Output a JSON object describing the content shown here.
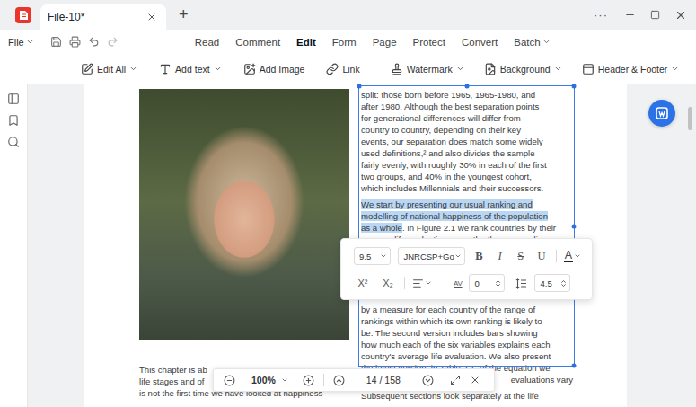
{
  "window": {
    "title": "File-10*",
    "new_tab": "+",
    "more": "···"
  },
  "menu": {
    "file": "File",
    "tabs": [
      {
        "label": "Read",
        "selected": false,
        "dropdown": false
      },
      {
        "label": "Comment",
        "selected": false,
        "dropdown": false
      },
      {
        "label": "Edit",
        "selected": true,
        "dropdown": false
      },
      {
        "label": "Form",
        "selected": false,
        "dropdown": false
      },
      {
        "label": "Page",
        "selected": false,
        "dropdown": false
      },
      {
        "label": "Protect",
        "selected": false,
        "dropdown": false
      },
      {
        "label": "Convert",
        "selected": false,
        "dropdown": false
      },
      {
        "label": "Batch",
        "selected": false,
        "dropdown": true
      }
    ]
  },
  "toolbar": {
    "edit_tools": [
      {
        "label": "Edit All",
        "dropdown": true
      },
      {
        "label": "Add text",
        "dropdown": true
      },
      {
        "label": "Add Image",
        "dropdown": false
      },
      {
        "label": "Link",
        "dropdown": false
      }
    ],
    "page_tools": [
      {
        "label": "Watermark",
        "dropdown": true
      },
      {
        "label": "Background",
        "dropdown": true
      },
      {
        "label": "Header & Footer",
        "dropdown": true
      }
    ]
  },
  "document": {
    "left_column": {
      "lines": [
        "This chapter is ab",
        "life stages and of",
        "is not the first time we have looked at happiness"
      ]
    },
    "right_column": {
      "above_toolbar": [
        {
          "lines": [
            {
              "segments": [
                {
                  "text": "split: those born before 1965, 1965-1980, and",
                  "highlighted": false
                }
              ],
              "cut_start": false
            },
            {
              "segments": [
                {
                  "text": "after 1980. Although the best separation points",
                  "highlighted": false
                }
              ],
              "cut_start": false
            },
            {
              "segments": [
                {
                  "text": "for generational differences will differ from",
                  "highlighted": false
                }
              ],
              "cut_start": false
            },
            {
              "segments": [
                {
                  "text": "country to country, depending on their key",
                  "highlighted": false
                }
              ],
              "cut_start": false
            },
            {
              "segments": [
                {
                  "text": "events, our separation does match some widely",
                  "highlighted": false
                }
              ],
              "cut_start": false
            },
            {
              "segments": [
                {
                  "text": "used definitions,² and also divides the sample",
                  "highlighted": false
                }
              ],
              "cut_start": false
            },
            {
              "segments": [
                {
                  "text": "fairly evenly, with roughly 30% in each of the first",
                  "highlighted": false
                }
              ],
              "cut_start": false
            },
            {
              "segments": [
                {
                  "text": "two groups, and 40% in the youngest cohort,",
                  "highlighted": false
                }
              ],
              "cut_start": false
            },
            {
              "segments": [
                {
                  "text": "which includes Millennials and their successors.",
                  "highlighted": false
                }
              ],
              "cut_start": false
            }
          ]
        },
        {
          "lines": [
            {
              "segments": [
                {
                  "text": "We start by presenting our usual ranking and",
                  "highlighted": true
                }
              ],
              "cut_start": false
            },
            {
              "segments": [
                {
                  "text": "modelling of national happiness of the population",
                  "highlighted": true
                }
              ],
              "cut_start": false
            },
            {
              "segments": [
                {
                  "text": "as a whole",
                  "highlighted": true
                },
                {
                  "text": ". In Figure 2.1 we rank countries by their",
                  "highlighted": false
                }
              ],
              "cut_start": false
            },
            {
              "segments": [
                {
                  "text": "average life evaluations over the three preceding",
                  "highlighted": false
                }
              ],
              "cut_start": false
            }
          ]
        }
      ],
      "below_toolbar": [
        {
          "lines": [
            {
              "segments": [
                {
                  "text": "by a measure for each country of the range of",
                  "highlighted": false
                }
              ],
              "cut_start": false
            },
            {
              "segments": [
                {
                  "text": "rankings within which its own ranking is likely to",
                  "highlighted": false
                }
              ],
              "cut_start": false
            },
            {
              "segments": [
                {
                  "text": "be. The second version includes bars showing",
                  "highlighted": false
                }
              ],
              "cut_start": false
            },
            {
              "segments": [
                {
                  "text": "how much each of the six variables explains each",
                  "highlighted": false
                }
              ],
              "cut_start": false
            },
            {
              "segments": [
                {
                  "text": "country's average life evaluation. We also present",
                  "highlighted": false
                }
              ],
              "cut_start": false
            },
            {
              "segments": [
                {
                  "text": "the latest version, in Table 2.1, of the equation we",
                  "highlighted": false
                }
              ],
              "cut_start": false
            },
            {
              "segments": [
                {
                  "text": "evaluations vary",
                  "highlighted": false
                }
              ],
              "cut_start": true
            }
          ]
        },
        {
          "lines": [
            {
              "segments": [
                {
                  "text": "Subsequent sections look separately at the life",
                  "highlighted": false
                }
              ],
              "cut_start": false
            }
          ]
        }
      ]
    }
  },
  "format_toolbar": {
    "font_size": "9.5",
    "font_name": "JNRCSP+Go",
    "styles": [
      {
        "label": "B",
        "kind": "bold",
        "on": false
      },
      {
        "label": "I",
        "kind": "italic",
        "on": false
      },
      {
        "label": "S",
        "kind": "strike",
        "on": false
      },
      {
        "label": "U",
        "kind": "underline",
        "on": false
      }
    ],
    "color_label": "A",
    "color": "#222222",
    "scripts": [
      {
        "label": "X²"
      },
      {
        "label": "X₂"
      }
    ],
    "spacing_label": "AV",
    "char_spacing": "0",
    "line_spacing": "4.5"
  },
  "zoom_bar": {
    "zoom": "100%",
    "page": "14 / 158"
  }
}
